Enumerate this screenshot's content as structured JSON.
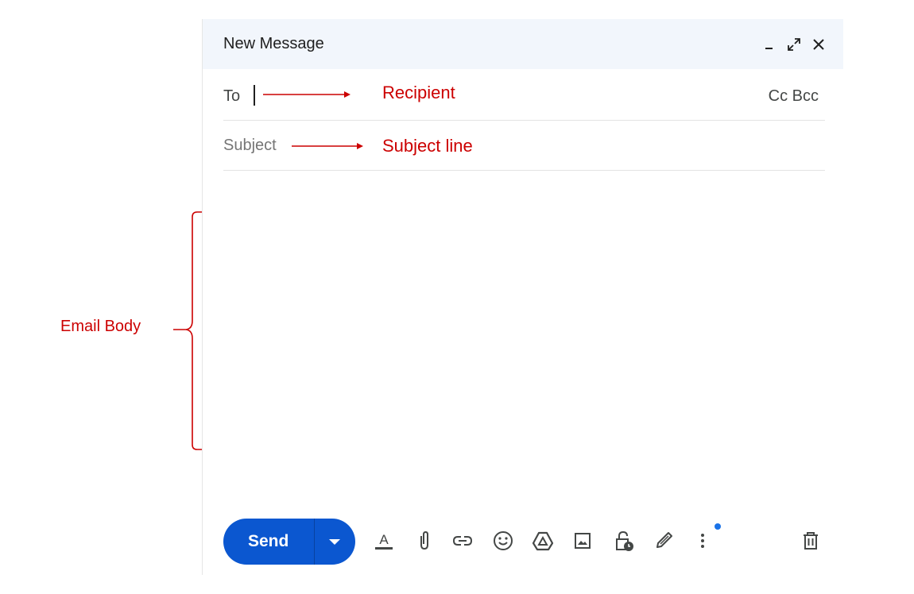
{
  "compose": {
    "title": "New Message",
    "to_label": "To",
    "cc_bcc_label": "Cc Bcc",
    "subject_placeholder": "Subject",
    "send_label": "Send"
  },
  "annotations": {
    "recipient": "Recipient",
    "subject_line": "Subject line",
    "email_body": "Email Body"
  },
  "colors": {
    "header_bg": "#f2f6fc",
    "send_button": "#0b57d0",
    "annotation": "#cc0000",
    "notification_dot": "#1a73e8"
  },
  "toolbar_icons": [
    "text-format-icon",
    "attach-icon",
    "link-icon",
    "emoji-icon",
    "drive-icon",
    "photo-icon",
    "confidential-lock-icon",
    "signature-pen-icon",
    "more-options-icon",
    "delete-trash-icon"
  ]
}
